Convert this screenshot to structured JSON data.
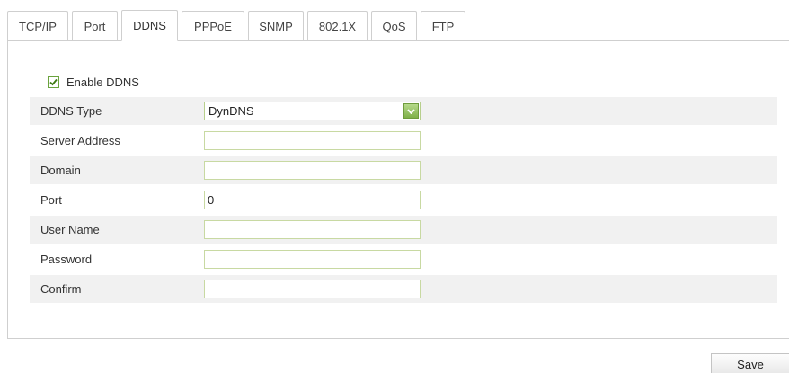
{
  "tabs": [
    {
      "label": "TCP/IP",
      "active": false
    },
    {
      "label": "Port",
      "active": false
    },
    {
      "label": "DDNS",
      "active": true
    },
    {
      "label": "PPPoE",
      "active": false
    },
    {
      "label": "SNMP",
      "active": false
    },
    {
      "label": "802.1X",
      "active": false
    },
    {
      "label": "QoS",
      "active": false
    },
    {
      "label": "FTP",
      "active": false
    }
  ],
  "enable_ddns": {
    "label": "Enable DDNS",
    "checked": true
  },
  "form": {
    "ddns_type": {
      "label": "DDNS Type",
      "value": "DynDNS"
    },
    "server_address": {
      "label": "Server Address",
      "value": ""
    },
    "domain": {
      "label": "Domain",
      "value": ""
    },
    "port": {
      "label": "Port",
      "value": "0"
    },
    "user_name": {
      "label": "User Name",
      "value": ""
    },
    "password": {
      "label": "Password",
      "value": ""
    },
    "confirm": {
      "label": "Confirm",
      "value": ""
    }
  },
  "save_label": "Save",
  "colors": {
    "accent_green": "#7fb04a",
    "row_shade": "#f1f1f1",
    "border": "#cfcfcf"
  }
}
